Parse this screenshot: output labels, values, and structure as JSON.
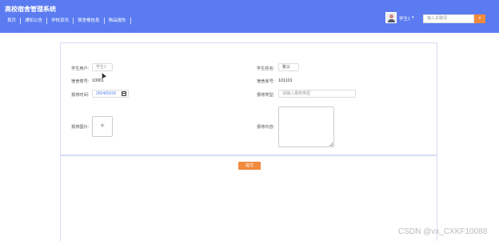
{
  "header": {
    "brand": "高校宿舍管理系统",
    "nav": [
      "首页",
      "通知公告",
      "学校资讯",
      "宿舍楼信息",
      "物品报失"
    ],
    "username": "学生1",
    "search_placeholder": "输入关键词"
  },
  "form": {
    "student_account_label": "学生用户:",
    "student_account_value": "学生1",
    "student_name_label": "学生姓名:",
    "student_name_value": "张三",
    "dorm_building_label": "宿舍楼号:",
    "dorm_building_value": "10001",
    "dorm_room_label": "宿舍房号:",
    "dorm_room_value": "101101",
    "repair_date_label": "报修时间:",
    "repair_date_value": "2024/03/16",
    "repair_type_label": "报修类型:",
    "repair_type_placeholder": "请输入报修类型",
    "repair_image_label": "报修图片:",
    "upload_plus": "+",
    "repair_content_label": "报修内容:",
    "submit_label": "提交"
  },
  "watermark": "CSDN @vx_CXKF10088"
}
